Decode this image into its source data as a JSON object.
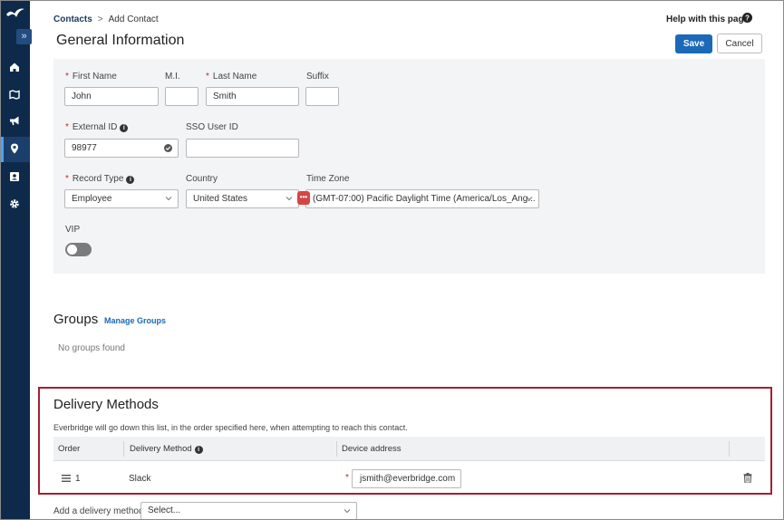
{
  "breadcrumb": {
    "parent": "Contacts",
    "separator": ">",
    "current": "Add Contact"
  },
  "header": {
    "title": "General Information",
    "help_label": "Help with this page",
    "save_label": "Save",
    "cancel_label": "Cancel"
  },
  "form": {
    "first_name": {
      "label": "First Name",
      "value": "John"
    },
    "mi": {
      "label": "M.I.",
      "value": ""
    },
    "last_name": {
      "label": "Last Name",
      "value": "Smith"
    },
    "suffix": {
      "label": "Suffix",
      "value": ""
    },
    "external_id": {
      "label": "External ID",
      "value": "98977"
    },
    "sso_user_id": {
      "label": "SSO User ID",
      "value": ""
    },
    "record_type": {
      "label": "Record Type",
      "value": "Employee"
    },
    "country": {
      "label": "Country",
      "value": "United States"
    },
    "time_zone": {
      "label": "Time Zone",
      "value": "(GMT-07:00) Pacific Daylight Time (America/Los_Ang..."
    },
    "vip": {
      "label": "VIP",
      "on": false
    },
    "badge_text": "•••"
  },
  "groups": {
    "title": "Groups",
    "manage_label": "Manage Groups",
    "empty_text": "No groups found"
  },
  "delivery": {
    "title": "Delivery Methods",
    "description": "Everbridge will go down this list, in the order specified here, when attempting to reach this contact.",
    "columns": [
      "Order",
      "Delivery Method",
      "Device address"
    ],
    "rows": [
      {
        "order": "1",
        "method": "Slack",
        "address": "jsmith@everbridge.com"
      }
    ],
    "add_label": "Add a delivery method:",
    "add_placeholder": "Select..."
  },
  "colors": {
    "sidebar": "#0d2a4a",
    "primary": "#1b69b8",
    "highlight_border": "#a32032",
    "required": "#c62828"
  },
  "icons": [
    "everbridge-logo",
    "expand-icon",
    "home-icon",
    "map-icon",
    "megaphone-icon",
    "location-pin-icon",
    "contacts-icon",
    "gear-icon",
    "help-icon",
    "info-icon",
    "check-icon",
    "chevron-down-icon",
    "drag-handle-icon",
    "trash-icon"
  ]
}
